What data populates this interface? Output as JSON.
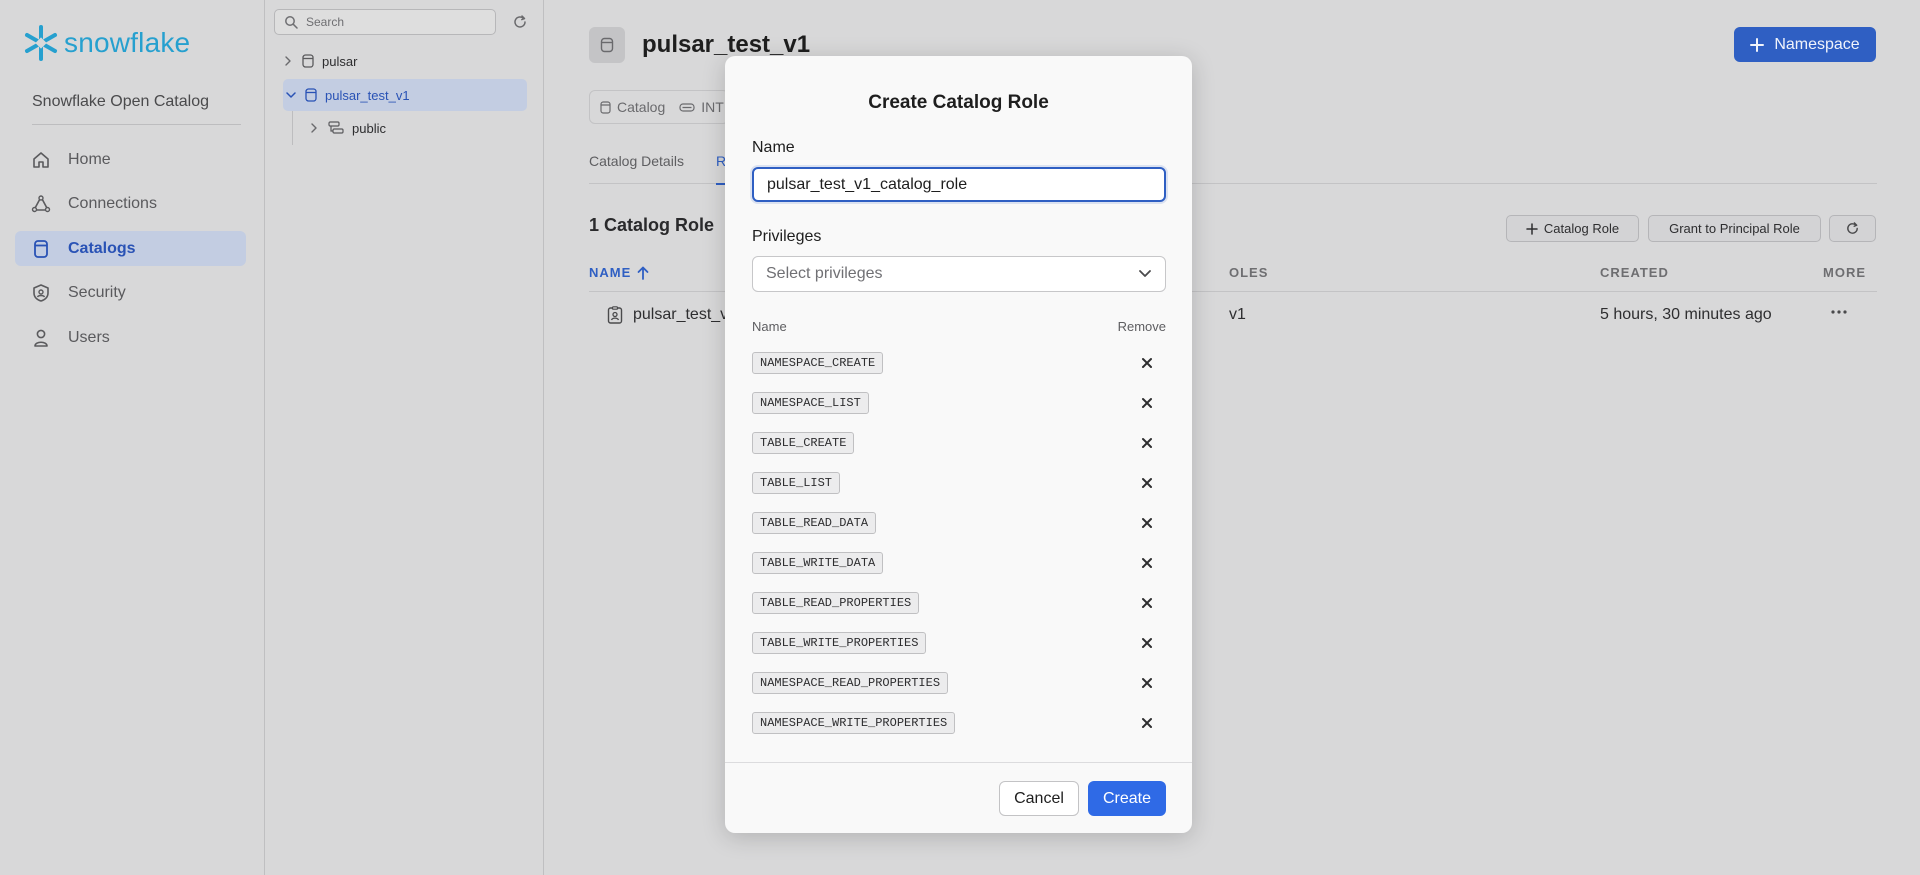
{
  "brand": {
    "name": "snowflake",
    "org": "Snowflake Open Catalog"
  },
  "nav": {
    "items": [
      {
        "label": "Home",
        "icon": "home-icon"
      },
      {
        "label": "Connections",
        "icon": "connections-icon"
      },
      {
        "label": "Catalogs",
        "icon": "catalog-icon",
        "active": true
      },
      {
        "label": "Security",
        "icon": "shield-icon"
      },
      {
        "label": "Users",
        "icon": "user-icon"
      }
    ]
  },
  "tree": {
    "search_placeholder": "Search",
    "nodes": [
      {
        "label": "pulsar",
        "expanded": false
      },
      {
        "label": "pulsar_test_v1",
        "expanded": true,
        "selected": true
      },
      {
        "label": "public",
        "expanded": false,
        "level": 2
      }
    ]
  },
  "main": {
    "title": "pulsar_test_v1",
    "namespace_button": "Namespace",
    "chips": {
      "type_label": "Catalog",
      "store_label": "INT"
    },
    "tabs": {
      "details": "Catalog Details",
      "roles": "R"
    },
    "role_count": "1 Catalog Role",
    "buttons": {
      "catalog_role": "Catalog Role",
      "grant": "Grant to Principal Role"
    },
    "table": {
      "headers": {
        "name": "NAME",
        "roles": "OLES",
        "created": "CREATED",
        "more": "MORE"
      },
      "rows": [
        {
          "name": "pulsar_test_v",
          "roles": "v1",
          "created": "5 hours, 30 minutes ago"
        }
      ]
    }
  },
  "modal": {
    "title": "Create Catalog Role",
    "name_label": "Name",
    "name_value": "pulsar_test_v1_catalog_role",
    "privileges_label": "Privileges",
    "select_placeholder": "Select privileges",
    "list_header_name": "Name",
    "list_header_remove": "Remove",
    "privileges": [
      "NAMESPACE_CREATE",
      "NAMESPACE_LIST",
      "TABLE_CREATE",
      "TABLE_LIST",
      "TABLE_READ_DATA",
      "TABLE_WRITE_DATA",
      "TABLE_READ_PROPERTIES",
      "TABLE_WRITE_PROPERTIES",
      "NAMESPACE_READ_PROPERTIES",
      "NAMESPACE_WRITE_PROPERTIES"
    ],
    "cancel": "Cancel",
    "create": "Create"
  },
  "colors": {
    "accent": "#2f5fc3",
    "brand": "#26a0cf",
    "create_button": "#2f6ae6"
  }
}
